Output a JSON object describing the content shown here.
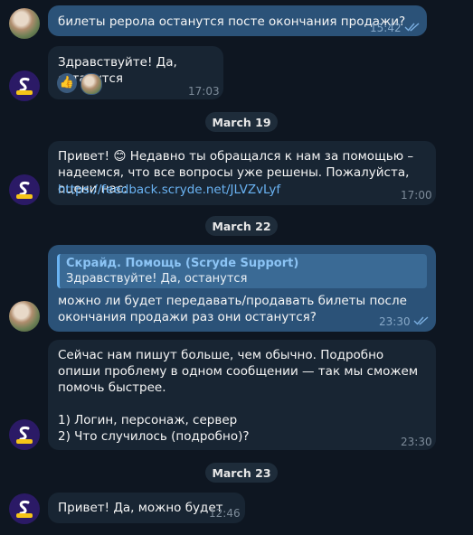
{
  "messages": [
    {
      "id": "m1",
      "text": "билеты реpола останутся посте окончания продажи?",
      "time": "15:42"
    },
    {
      "id": "m2",
      "text": "Здравствуйте! Да, останутся",
      "time": "17:03",
      "reactions": [
        "thumbs-up",
        "user-avatar"
      ]
    },
    {
      "id": "m3",
      "text_before": "Привет! 😊 Недавно ты обращался к нам за помощью – надеемся, что все вопросы уже решены. Пожалуйста, оцени нас:",
      "link": "https://feedback.scryde.net/JLVZvLyf",
      "time": "17:00"
    },
    {
      "id": "m4",
      "reply_author": "Скрайд. Помощь (Scryde Support)",
      "reply_text": "Здравствуйте! Да, останутся",
      "text": "можно ли будет передавать/продавать билеты после окончания продажи раз они останутся?",
      "time": "23:30"
    },
    {
      "id": "m5",
      "text": "Сейчас нам пишут больше, чем обычно. Подробно опиши проблему в одном сообщении — так мы сможем помочь быстрее.\n\n1) Логин, персонаж, сервер\n2) Что случилось (подробно)?",
      "time": "23:30"
    },
    {
      "id": "m6",
      "text": "Привет! Да, можно будет",
      "time": "12:46"
    }
  ],
  "dates": {
    "d1": "March 19",
    "d2": "March 22",
    "d3": "March 23"
  },
  "colors": {
    "outgoing": "#2b5278",
    "incoming": "#182533",
    "link": "#6ab3f3",
    "background": "#0e1621"
  }
}
